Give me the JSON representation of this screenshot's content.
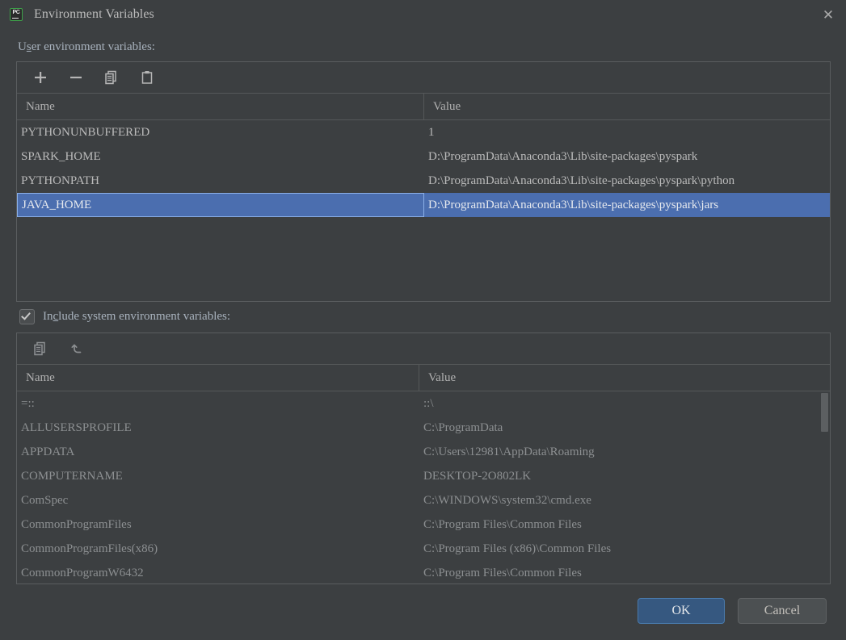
{
  "window": {
    "title": "Environment Variables",
    "app_icon": "pycharm-icon",
    "icon_text": "PC",
    "close_label": "✕"
  },
  "user_section": {
    "label_pre": "U",
    "label_mnemonic": "s",
    "label_post": "er environment variables:",
    "toolbar": [
      {
        "name": "add-button",
        "icon": "plus-icon",
        "tooltip": "Add"
      },
      {
        "name": "remove-button",
        "icon": "minus-icon",
        "tooltip": "Remove"
      },
      {
        "name": "copy-button",
        "icon": "copy-icon",
        "tooltip": "Copy"
      },
      {
        "name": "paste-button",
        "icon": "paste-icon",
        "tooltip": "Paste"
      }
    ],
    "columns": [
      "Name",
      "Value"
    ],
    "rows": [
      {
        "name": "PYTHONUNBUFFERED",
        "value": "1",
        "selected": false
      },
      {
        "name": "SPARK_HOME",
        "value": "D:\\ProgramData\\Anaconda3\\Lib\\site-packages\\pyspark",
        "selected": false
      },
      {
        "name": "PYTHONPATH",
        "value": "D:\\ProgramData\\Anaconda3\\Lib\\site-packages\\pyspark\\python",
        "selected": false
      },
      {
        "name": "JAVA_HOME",
        "value": "D:\\ProgramData\\Anaconda3\\Lib\\site-packages\\pyspark\\jars",
        "selected": true
      }
    ]
  },
  "include_system": {
    "checked": true,
    "label_pre": "In",
    "label_mnemonic": "c",
    "label_post": "lude system environment variables:"
  },
  "system_section": {
    "toolbar": [
      {
        "name": "copy-button",
        "icon": "copy-icon",
        "tooltip": "Copy"
      },
      {
        "name": "revert-button",
        "icon": "undo-icon",
        "tooltip": "Revert"
      }
    ],
    "columns": [
      "Name",
      "Value"
    ],
    "rows": [
      {
        "name": "=::",
        "value": "::\\"
      },
      {
        "name": "ALLUSERSPROFILE",
        "value": "C:\\ProgramData"
      },
      {
        "name": "APPDATA",
        "value": "C:\\Users\\12981\\AppData\\Roaming"
      },
      {
        "name": "COMPUTERNAME",
        "value": "DESKTOP-2O802LK"
      },
      {
        "name": "ComSpec",
        "value": "C:\\WINDOWS\\system32\\cmd.exe"
      },
      {
        "name": "CommonProgramFiles",
        "value": "C:\\Program Files\\Common Files"
      },
      {
        "name": "CommonProgramFiles(x86)",
        "value": "C:\\Program Files (x86)\\Common Files"
      },
      {
        "name": "CommonProgramW6432",
        "value": "C:\\Program Files\\Common Files"
      }
    ],
    "scrollbar": {
      "thumb_top_pct": 0,
      "thumb_height_pct": 20
    }
  },
  "footer": {
    "ok_label": "OK",
    "cancel_label": "Cancel"
  },
  "colors": {
    "dialog_bg": "#3c3f41",
    "selection_blue": "#4b6eaf",
    "selection_border": "#8cb0e8",
    "ok_button_bg": "#365880",
    "text": "#bbbbbb",
    "label_text": "#a8b2bd",
    "disabled_text": "#8c8f91",
    "border": "#5a5d5f",
    "icon_accent_green": "#3ea14a"
  }
}
